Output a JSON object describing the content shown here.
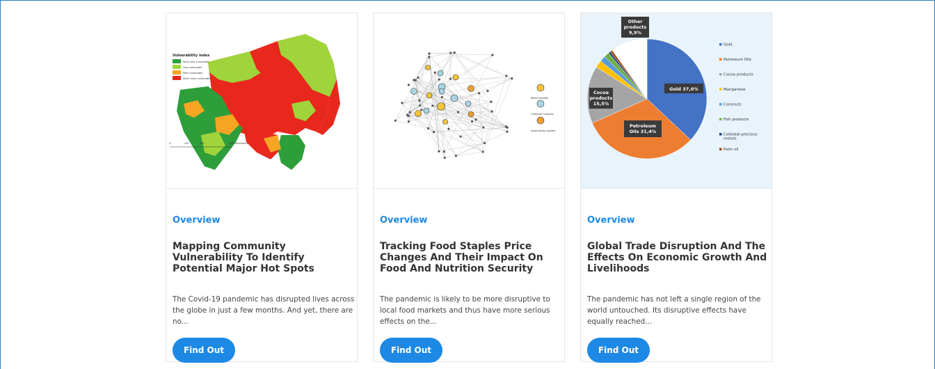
{
  "cards": [
    {
      "overview": "Overview",
      "title": "Mapping Community Vulnerability To Identify Potential Major Hot Spots",
      "description": "The Covid-19 pandemic has disrupted lives across the globe in just a few months. And yet, there are no...",
      "button": "Find Out",
      "image": {
        "legend_title": "Vulnerability index",
        "legend_items": [
          "Much less vulnerable",
          "Less vulnerable",
          "More vulnerable",
          "Much more vulnerable"
        ],
        "legend_colors": [
          "#2e9e3a",
          "#9fd53a",
          "#f7a623",
          "#e8281c"
        ],
        "scale_labels": [
          "0",
          "250",
          "500",
          "1 000 Kilometers"
        ]
      }
    },
    {
      "overview": "Overview",
      "title": "Tracking Food Staples Price Changes And Their Impact On Food And Nutrition Security",
      "description": "The pandemic is likely to be more disruptive to local food markets and thus have more serious effects on the...",
      "button": "Find Out",
      "image": {
        "legend_items": [
          "Retail markets",
          "Collection markets",
          "Assembling markets"
        ],
        "legend_colors": [
          "#f5c43b",
          "#a9d5e6",
          "#f0a030"
        ]
      }
    },
    {
      "overview": "Overview",
      "title": "Global Trade Disruption And The Effects On Economic Growth And Livelihoods",
      "description": "The pandemic has not left a single region of the world untouched. Its disruptive effects have equally reached...",
      "button": "Find Out",
      "image": {
        "labels": {
          "gold": "Gold 37,0%",
          "oils": "Petroleum Oils 31,4%",
          "cocoa": "Cocoa products 15,5%",
          "other": "Other products 9,9%"
        },
        "legend": [
          {
            "name": "Gold",
            "color": "#4472c4"
          },
          {
            "name": "Petroleum Oils",
            "color": "#ed7d31"
          },
          {
            "name": "Cocoa products",
            "color": "#a5a5a5"
          },
          {
            "name": "Manganese",
            "color": "#ffc000"
          },
          {
            "name": "Coconuts",
            "color": "#5b9bd5"
          },
          {
            "name": "Fish products",
            "color": "#70ad47"
          },
          {
            "name": "Colloidal precious metals",
            "color": "#264478"
          },
          {
            "name": "Palm oil",
            "color": "#9e480e"
          }
        ]
      }
    }
  ]
}
